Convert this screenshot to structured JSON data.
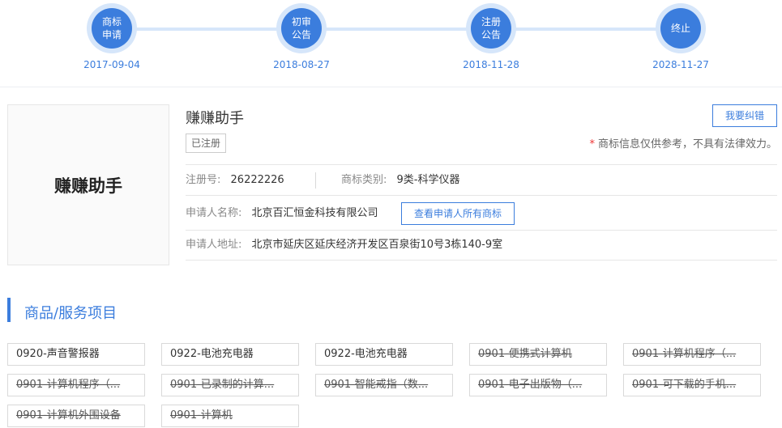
{
  "timeline": [
    {
      "label": "商标申请",
      "date": "2017-09-04"
    },
    {
      "label": "初审公告",
      "date": "2018-08-27"
    },
    {
      "label": "注册公告",
      "date": "2018-11-28"
    },
    {
      "label": "终止",
      "date": "2028-11-27"
    }
  ],
  "trademark": {
    "logo_text": "赚赚助手",
    "name": "赚赚助手",
    "status": "已注册",
    "report_label": "我要纠错",
    "disclaimer": "商标信息仅供参考，不具有法律效力。",
    "reg_no_label": "注册号:",
    "reg_no": "26222226",
    "class_label": "商标类别:",
    "class_value": "9类-科学仪器",
    "applicant_label": "申请人名称:",
    "applicant": "北京百汇恒金科技有限公司",
    "view_all_label": "查看申请人所有商标",
    "address_label": "申请人地址:",
    "address": "北京市延庆区延庆经济开发区百泉街10号3栋140-9室"
  },
  "goods_section": {
    "title": "商品/服务项目",
    "items": [
      {
        "text": "0920-声音警报器",
        "struck": false
      },
      {
        "text": "0922-电池充电器",
        "struck": false
      },
      {
        "text": "0922-电池充电器",
        "struck": false
      },
      {
        "text": "0901-便携式计算机",
        "struck": true
      },
      {
        "text": "0901-计算机程序（...",
        "struck": true
      },
      {
        "text": "0901-计算机程序（...",
        "struck": true
      },
      {
        "text": "0901-已录制的计算...",
        "struck": true
      },
      {
        "text": "0901-智能戒指（数...",
        "struck": true
      },
      {
        "text": "0901-电子出版物（...",
        "struck": true
      },
      {
        "text": "0901-可下载的手机...",
        "struck": true
      },
      {
        "text": "0901-计算机外围设备",
        "struck": true
      },
      {
        "text": "0901-计算机",
        "struck": true
      }
    ]
  },
  "colors": {
    "accent": "#3b7ddd",
    "accent_light": "#d6e6fa",
    "required_star": "#e33333"
  }
}
